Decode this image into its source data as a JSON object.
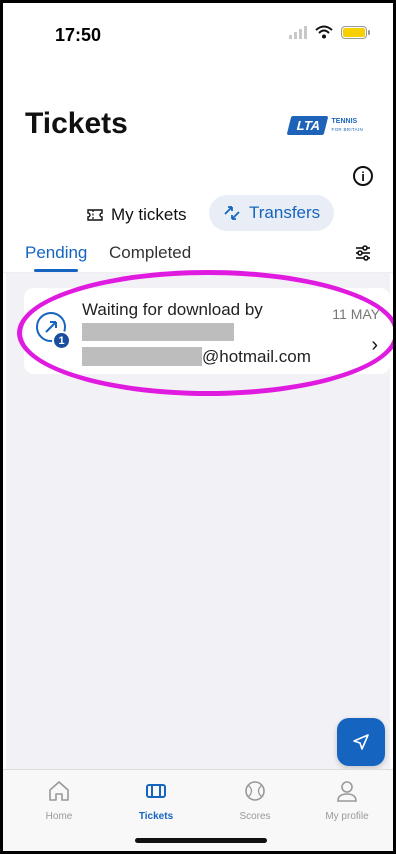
{
  "status_bar": {
    "time": "17:50"
  },
  "header": {
    "title": "Tickets",
    "logo": {
      "badge": "LTA",
      "line1": "TENNIS",
      "line2": "FOR BRITAIN"
    }
  },
  "segment": {
    "my_tickets": "My tickets",
    "transfers": "Transfers"
  },
  "tabs": {
    "pending": "Pending",
    "completed": "Completed"
  },
  "transfer_card": {
    "title": "Waiting for download by",
    "date": "11 MAY",
    "email_suffix": "@hotmail.com",
    "badge_count": "1"
  },
  "tabbar": [
    {
      "label": "Home",
      "icon": "home-icon"
    },
    {
      "label": "Tickets",
      "icon": "ticket-icon"
    },
    {
      "label": "Scores",
      "icon": "tennis-ball-icon"
    },
    {
      "label": "My profile",
      "icon": "profile-icon"
    }
  ],
  "colors": {
    "accent": "#1565c0",
    "highlight": "#e01be0",
    "logo": "#1e63b8"
  }
}
